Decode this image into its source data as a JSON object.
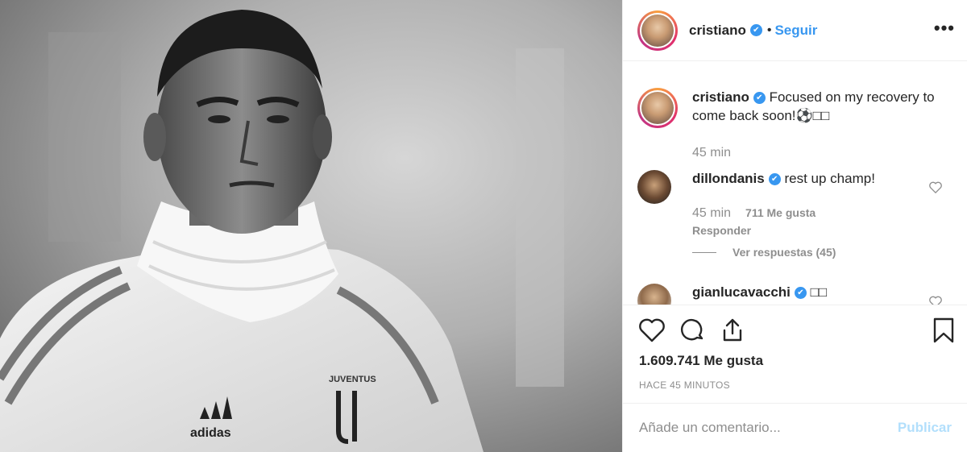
{
  "post": {
    "author": "cristiano",
    "verified_mark": "✔",
    "separator": "•",
    "follow_label": "Seguir",
    "more_label": "•••"
  },
  "caption": {
    "username": "cristiano",
    "text": "Focused on my recovery to come back soon!⚽□□",
    "time": "45 min"
  },
  "comments": [
    {
      "username": "dillondanis",
      "text": "rest up champ!",
      "time": "45 min",
      "likes": "711 Me gusta",
      "reply_label": "Responder",
      "view_replies_label": "Ver respuestas (45)"
    },
    {
      "username": "gianlucavacchi",
      "text": "□□"
    }
  ],
  "stats": {
    "likes": "1.609.741 Me gusta",
    "timeago": "HACE 45 MINUTOS"
  },
  "add_comment": {
    "placeholder": "Añade un comentario...",
    "publish_label": "Publicar"
  },
  "photo": {
    "jersey_brand": "adidas",
    "jersey_crest": "JUVENTUS"
  },
  "colors": {
    "accent": "#3897f0",
    "text": "#262626",
    "muted": "#8e8e8e",
    "publish_disabled": "#b2dffc",
    "border": "#efefef"
  },
  "icons": {
    "like": "heart-icon",
    "comment": "comment-icon",
    "share": "share-icon",
    "save": "bookmark-icon",
    "comment_like": "heart-icon",
    "options": "more-options-icon"
  }
}
